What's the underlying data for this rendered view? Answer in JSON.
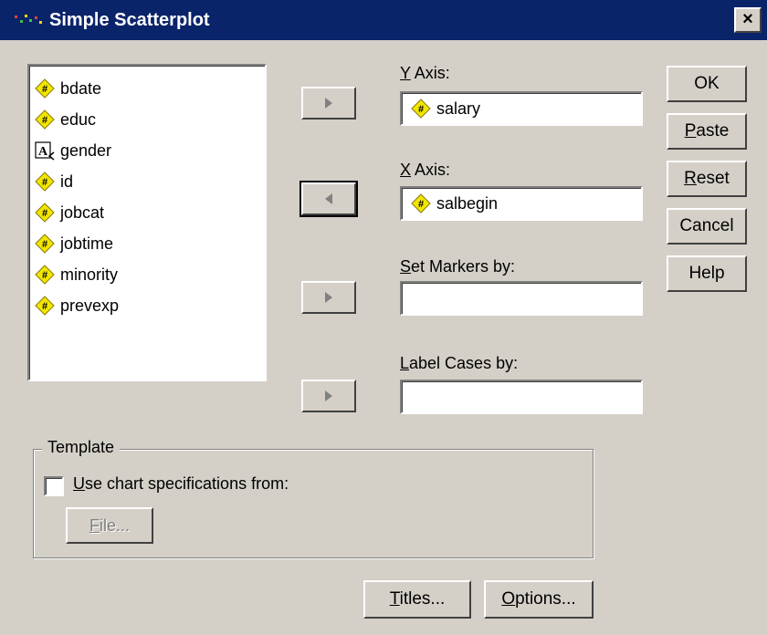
{
  "window": {
    "title": "Simple Scatterplot",
    "close_symbol": "×"
  },
  "variables": [
    {
      "name": "bdate",
      "type": "numeric",
      "icon": "numeric-variable-icon"
    },
    {
      "name": "educ",
      "type": "numeric",
      "icon": "numeric-variable-icon"
    },
    {
      "name": "gender",
      "type": "string",
      "icon": "string-variable-icon"
    },
    {
      "name": "id",
      "type": "numeric",
      "icon": "numeric-variable-icon"
    },
    {
      "name": "jobcat",
      "type": "numeric",
      "icon": "numeric-variable-icon"
    },
    {
      "name": "jobtime",
      "type": "numeric",
      "icon": "numeric-variable-icon"
    },
    {
      "name": "minority",
      "type": "numeric",
      "icon": "numeric-variable-icon"
    },
    {
      "name": "prevexp",
      "type": "numeric",
      "icon": "numeric-variable-icon"
    }
  ],
  "fields": {
    "y_axis": {
      "label_mnemonic": "Y",
      "label_rest": " Axis:",
      "value": "salary"
    },
    "x_axis": {
      "label_mnemonic": "X",
      "label_rest": " Axis:",
      "value": "salbegin"
    },
    "set_markers": {
      "label_mnemonic": "S",
      "label_rest": "et Markers by:",
      "value": ""
    },
    "label_cases": {
      "label_mnemonic": "L",
      "label_rest": "abel Cases by:",
      "value": ""
    }
  },
  "buttons": {
    "ok": "OK",
    "paste_mnemonic": "P",
    "paste_rest": "aste",
    "reset_mnemonic": "R",
    "reset_rest": "eset",
    "cancel": "Cancel",
    "help": "Help",
    "titles_mnemonic": "T",
    "titles_rest": "itles...",
    "options_mnemonic": "O",
    "options_rest": "ptions...",
    "file_mnemonic": "F",
    "file_rest": "ile..."
  },
  "template": {
    "group_title": "Template",
    "checkbox_mnemonic": "U",
    "checkbox_rest": "se chart specifications from:",
    "checked": false
  },
  "colors": {
    "titlebar": "#0a246a",
    "face": "#d4d0c8",
    "numeric_icon": "#f2e600"
  }
}
